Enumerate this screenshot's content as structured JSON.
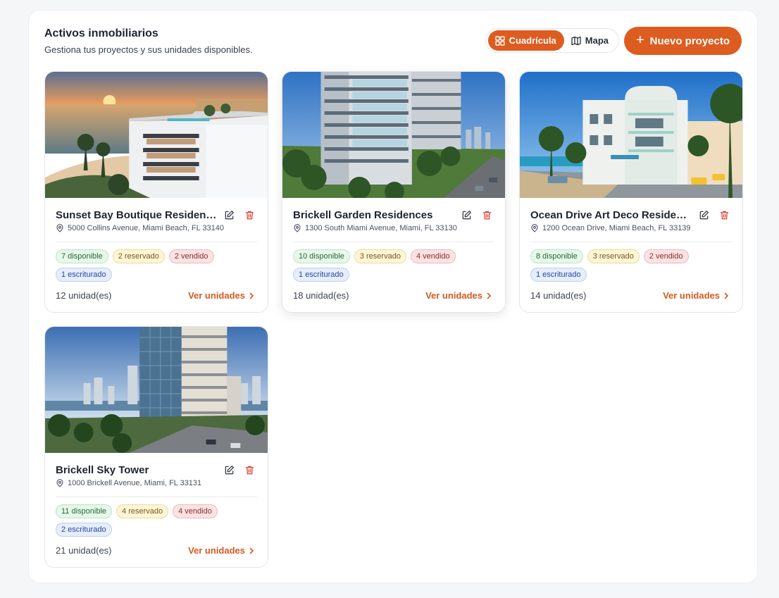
{
  "header": {
    "title": "Activos inmobiliarios",
    "subtitle": "Gestiona tus proyectos y sus unidades disponibles.",
    "view_grid_label": "Cuadrícula",
    "view_map_label": "Mapa",
    "new_project_label": "Nuevo proyecto"
  },
  "colors": {
    "accent": "#dd5c20",
    "available": "#e7f7ea",
    "reserved": "#fdf5d9",
    "sold": "#fbe3e3",
    "deeded": "#e6eefc"
  },
  "projects": [
    {
      "name": "Sunset Bay Boutique Residences",
      "address": "5000 Collins Avenue, Miami Beach, FL 33140",
      "available": "7 disponible",
      "reserved": "2 reservado",
      "sold": "2 vendido",
      "deeded": "1 escriturado",
      "units": "12 unidad(es)",
      "link": "Ver unidades"
    },
    {
      "name": "Brickell Garden Residences",
      "address": "1300 South Miami Avenue, Miami, FL 33130",
      "available": "10 disponible",
      "reserved": "3 reservado",
      "sold": "4 vendido",
      "deeded": "1 escriturado",
      "units": "18 unidad(es)",
      "link": "Ver unidades"
    },
    {
      "name": "Ocean Drive Art Deco Residences",
      "address": "1200 Ocean Drive, Miami Beach, FL 33139",
      "available": "8 disponible",
      "reserved": "3 reservado",
      "sold": "2 vendido",
      "deeded": "1 escriturado",
      "units": "14 unidad(es)",
      "link": "Ver unidades"
    },
    {
      "name": "Brickell Sky Tower",
      "address": "1000 Brickell Avenue, Miami, FL 33131",
      "available": "11 disponible",
      "reserved": "4 reservado",
      "sold": "4 vendido",
      "deeded": "2 escriturado",
      "units": "21 unidad(es)",
      "link": "Ver unidades"
    }
  ]
}
